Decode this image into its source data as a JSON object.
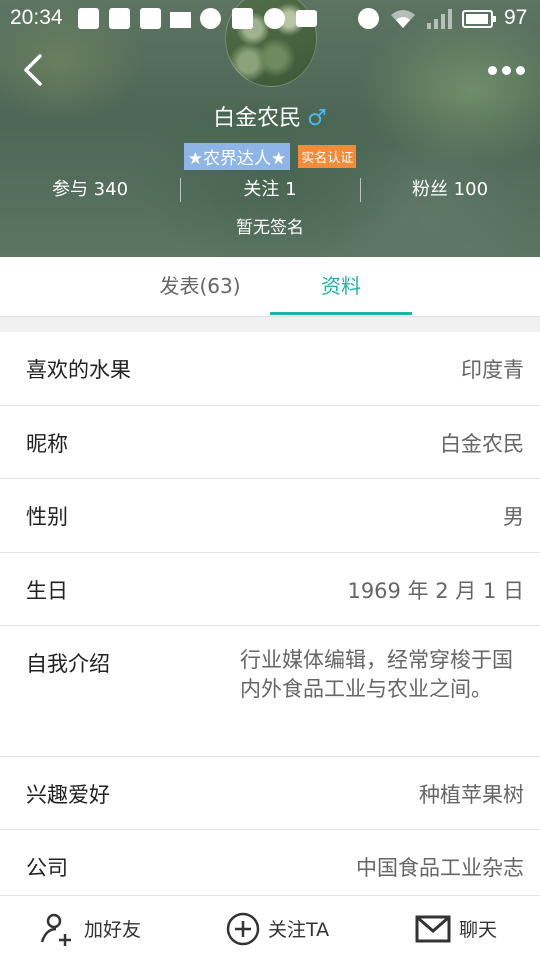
{
  "status_bar": {
    "time": "20:34",
    "battery": "97",
    "icons": [
      "weibo-icon",
      "pocket-icon",
      "pocket-icon",
      "broom-icon",
      "download-icon",
      "telegram-icon",
      "clock-icon",
      "image-icon",
      "alarm-icon",
      "wifi-icon",
      "signal-icon",
      "battery-icon"
    ]
  },
  "profile": {
    "name": "白金农民",
    "gender_symbol": "♂",
    "badge_expert": "★农界达人★",
    "badge_verified": "实名认证",
    "stats": {
      "participate": "参与 340",
      "following": "关注 1",
      "fans": "粉丝 100"
    },
    "signature": "暂无签名"
  },
  "tabs": {
    "posts": "发表(63)",
    "profile": "资料",
    "active": "profile"
  },
  "details": [
    {
      "label": "喜欢的水果",
      "value": "印度青"
    },
    {
      "label": "昵称",
      "value": "白金农民"
    },
    {
      "label": "性别",
      "value": "男"
    },
    {
      "label": "生日",
      "value": "1969 年 2 月 1 日"
    },
    {
      "label": "自我介绍",
      "value": "行业媒体编辑，经常穿梭于国内外食品工业与农业之间。"
    },
    {
      "label": "兴趣爱好",
      "value": "种植苹果树"
    },
    {
      "label": "公司",
      "value": "中国食品工业杂志"
    }
  ],
  "bottom_actions": {
    "add_friend": "加好友",
    "follow": "关注TA",
    "chat": "聊天"
  },
  "colors": {
    "accent": "#22b3a4",
    "gender": "#4fb5ee",
    "badge_expert": "#8fb5e6",
    "badge_verified": "#f08c3a"
  }
}
